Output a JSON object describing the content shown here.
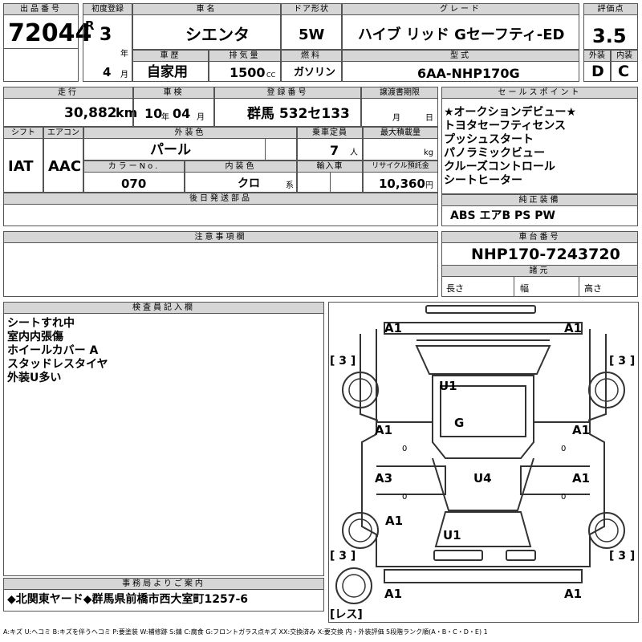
{
  "header": {
    "lot_label": "出品番号",
    "lot_no": "72044",
    "first_reg_label": "初度登録",
    "era": "R",
    "year": "3",
    "year_unit": "年",
    "month": "4",
    "month_unit": "月",
    "car_name_label": "車名",
    "car_name": "シエンタ",
    "door_label": "ドア形状",
    "door": "5W",
    "grade_label": "グレード",
    "grade": "ハイブ リッド Gセーフティ-ED",
    "rating_label": "評価点",
    "rating": "3.5",
    "history_label": "車歴",
    "history": "自家用",
    "displacement_label": "排気量",
    "displacement": "1500",
    "displacement_unit": "CC",
    "fuel_label": "燃料",
    "fuel": "ガソリン",
    "model_label": "型式",
    "model": "6AA-NHP170G",
    "ext_label": "外装",
    "ext": "D",
    "int_label": "内装",
    "int": "C"
  },
  "row2": {
    "mileage_label": "走行",
    "mileage": "30,882",
    "mileage_unit": "km",
    "inspection_label": "車検",
    "insp_year": "10",
    "insp_year_unit": "年",
    "insp_month": "04",
    "insp_month_unit": "月",
    "reg_label": "登録番号",
    "reg_no": "群馬 532セ133",
    "transfer_label": "譲渡書期限",
    "transfer_month": "月",
    "transfer_day": "日",
    "shift_label": "シフト",
    "shift": "IAT",
    "ac_label": "エアコン",
    "ac": "AAC",
    "color_label": "外装色",
    "color": "パール",
    "capacity_label": "乗車定員",
    "capacity": "7",
    "capacity_unit": "人",
    "load_label": "最大積載量",
    "load_unit": "kg",
    "color_no_label": "カラーNo.",
    "color_no": "070",
    "interior_color_label": "内装色",
    "interior_color": "クロ",
    "interior_unit": "系",
    "import_label": "輸入車",
    "recycle_label": "リサイクル預託金",
    "recycle": "10,360",
    "recycle_unit": "円",
    "later_label": "後日発送部品"
  },
  "sales_points": {
    "label": "セールスポイント",
    "items": [
      "★オークションデビュー★",
      "トヨタセーフティセンス",
      "プッシュスタート",
      "パノラミックビュー",
      "クルーズコントロール",
      "シートヒーター"
    ]
  },
  "equipment": {
    "label": "純正装備",
    "value": "ABS エアB PS PW"
  },
  "notes": {
    "label": "注意事項欄"
  },
  "chassis": {
    "label": "車台番号",
    "value": "NHP170-7243720",
    "dims_label": "諸元",
    "length_label": "長さ",
    "width_label": "幅",
    "height_label": "高さ"
  },
  "inspector": {
    "label": "検査員記入欄",
    "items": [
      "シートすれ中",
      "室内内張傷",
      "ホイールカバー A",
      "スタッドレスタイヤ",
      "外装U多い"
    ]
  },
  "office": {
    "label": "事務局よりご案内",
    "value": "◆北関東ヤード◆群馬県前橋市西大室町1257-6"
  },
  "diagram": {
    "marks": [
      "A1",
      "A1",
      "U1",
      "G",
      "A1",
      "A1",
      "A3",
      "U4",
      "A1",
      "A1",
      "U1",
      "A1",
      "A1"
    ],
    "tire": "[ 3 ]",
    "zero": "0",
    "spare": "[レス]"
  },
  "legend": "A:キズ U:ヘコミ B:キズを伴うヘコミ P:要塗装 W:補修跡 S:錆 C:腐食 G:フロントガラス点キズ XX:交換済み X:要交換 内・外装評価 5段階ランク順(A・B・C・D・E) 1"
}
